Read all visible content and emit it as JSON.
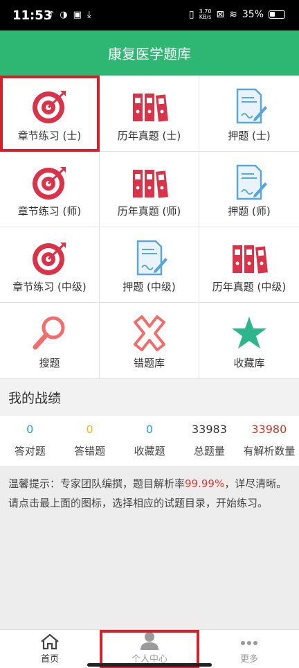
{
  "status_bar": {
    "time": "11:53",
    "left_icons": [
      "tiktok-icon",
      "app-icon",
      "shield-icon",
      "download-icon"
    ],
    "speed_value": "3.70",
    "speed_unit": "KB/s",
    "battery": "35%"
  },
  "header": {
    "title": "康复医学题库"
  },
  "grid": {
    "items": [
      {
        "label": "章节练习 (士)",
        "icon": "target-icon"
      },
      {
        "label": "历年真题 (士)",
        "icon": "binders-icon"
      },
      {
        "label": "押题 (士)",
        "icon": "document-pen-icon"
      },
      {
        "label": "章节练习 (师)",
        "icon": "target-icon"
      },
      {
        "label": "历年真题 (师)",
        "icon": "binders-icon"
      },
      {
        "label": "押题 (师)",
        "icon": "document-pen-icon"
      },
      {
        "label": "章节练习 (中级)",
        "icon": "target-icon"
      },
      {
        "label": "押题 (中级)",
        "icon": "document-pen-icon"
      },
      {
        "label": "历年真题 (中级)",
        "icon": "binders-icon"
      },
      {
        "label": "搜题",
        "icon": "search-icon"
      },
      {
        "label": "错题库",
        "icon": "cross-icon"
      },
      {
        "label": "收藏库",
        "icon": "star-icon"
      }
    ]
  },
  "stats": {
    "title": "我的战绩",
    "items": [
      {
        "value": "0",
        "label": "答对题",
        "color": "#2a9fd6"
      },
      {
        "value": "0",
        "label": "答错题",
        "color": "#f0b323"
      },
      {
        "value": "0",
        "label": "收藏题",
        "color": "#2a9fd6"
      },
      {
        "value": "33983",
        "label": "总题量",
        "color": "#333333"
      },
      {
        "value": "33980",
        "label": "有解析数量",
        "color": "#c0392b"
      }
    ]
  },
  "tips": {
    "line1_prefix": "温馨提示：专家团队编撰，题目解析率",
    "line1_rate": "99.99%",
    "line1_suffix": "，详尽清晰。",
    "line2": "请点击最上面的图标，选择相应的试题目录，开始练习。"
  },
  "bottom_nav": {
    "items": [
      {
        "label": "首页",
        "icon": "home-icon"
      },
      {
        "label": "个人中心",
        "icon": "user-icon"
      },
      {
        "label": "更多",
        "icon": "more-icon"
      }
    ]
  },
  "colors": {
    "header_green": "#2db773",
    "icon_red": "#d9334a",
    "icon_blue": "#5aa6d6",
    "highlight_red": "#d6212b"
  }
}
